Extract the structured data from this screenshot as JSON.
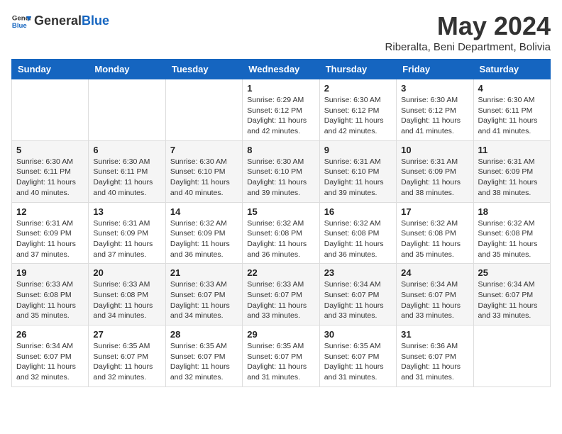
{
  "header": {
    "logo_general": "General",
    "logo_blue": "Blue",
    "month_title": "May 2024",
    "location": "Riberalta, Beni Department, Bolivia"
  },
  "days_of_week": [
    "Sunday",
    "Monday",
    "Tuesday",
    "Wednesday",
    "Thursday",
    "Friday",
    "Saturday"
  ],
  "weeks": [
    [
      {
        "day": "",
        "info": ""
      },
      {
        "day": "",
        "info": ""
      },
      {
        "day": "",
        "info": ""
      },
      {
        "day": "1",
        "info": "Sunrise: 6:29 AM\nSunset: 6:12 PM\nDaylight: 11 hours and 42 minutes."
      },
      {
        "day": "2",
        "info": "Sunrise: 6:30 AM\nSunset: 6:12 PM\nDaylight: 11 hours and 42 minutes."
      },
      {
        "day": "3",
        "info": "Sunrise: 6:30 AM\nSunset: 6:12 PM\nDaylight: 11 hours and 41 minutes."
      },
      {
        "day": "4",
        "info": "Sunrise: 6:30 AM\nSunset: 6:11 PM\nDaylight: 11 hours and 41 minutes."
      }
    ],
    [
      {
        "day": "5",
        "info": "Sunrise: 6:30 AM\nSunset: 6:11 PM\nDaylight: 11 hours and 40 minutes."
      },
      {
        "day": "6",
        "info": "Sunrise: 6:30 AM\nSunset: 6:11 PM\nDaylight: 11 hours and 40 minutes."
      },
      {
        "day": "7",
        "info": "Sunrise: 6:30 AM\nSunset: 6:10 PM\nDaylight: 11 hours and 40 minutes."
      },
      {
        "day": "8",
        "info": "Sunrise: 6:30 AM\nSunset: 6:10 PM\nDaylight: 11 hours and 39 minutes."
      },
      {
        "day": "9",
        "info": "Sunrise: 6:31 AM\nSunset: 6:10 PM\nDaylight: 11 hours and 39 minutes."
      },
      {
        "day": "10",
        "info": "Sunrise: 6:31 AM\nSunset: 6:09 PM\nDaylight: 11 hours and 38 minutes."
      },
      {
        "day": "11",
        "info": "Sunrise: 6:31 AM\nSunset: 6:09 PM\nDaylight: 11 hours and 38 minutes."
      }
    ],
    [
      {
        "day": "12",
        "info": "Sunrise: 6:31 AM\nSunset: 6:09 PM\nDaylight: 11 hours and 37 minutes."
      },
      {
        "day": "13",
        "info": "Sunrise: 6:31 AM\nSunset: 6:09 PM\nDaylight: 11 hours and 37 minutes."
      },
      {
        "day": "14",
        "info": "Sunrise: 6:32 AM\nSunset: 6:09 PM\nDaylight: 11 hours and 36 minutes."
      },
      {
        "day": "15",
        "info": "Sunrise: 6:32 AM\nSunset: 6:08 PM\nDaylight: 11 hours and 36 minutes."
      },
      {
        "day": "16",
        "info": "Sunrise: 6:32 AM\nSunset: 6:08 PM\nDaylight: 11 hours and 36 minutes."
      },
      {
        "day": "17",
        "info": "Sunrise: 6:32 AM\nSunset: 6:08 PM\nDaylight: 11 hours and 35 minutes."
      },
      {
        "day": "18",
        "info": "Sunrise: 6:32 AM\nSunset: 6:08 PM\nDaylight: 11 hours and 35 minutes."
      }
    ],
    [
      {
        "day": "19",
        "info": "Sunrise: 6:33 AM\nSunset: 6:08 PM\nDaylight: 11 hours and 35 minutes."
      },
      {
        "day": "20",
        "info": "Sunrise: 6:33 AM\nSunset: 6:08 PM\nDaylight: 11 hours and 34 minutes."
      },
      {
        "day": "21",
        "info": "Sunrise: 6:33 AM\nSunset: 6:07 PM\nDaylight: 11 hours and 34 minutes."
      },
      {
        "day": "22",
        "info": "Sunrise: 6:33 AM\nSunset: 6:07 PM\nDaylight: 11 hours and 33 minutes."
      },
      {
        "day": "23",
        "info": "Sunrise: 6:34 AM\nSunset: 6:07 PM\nDaylight: 11 hours and 33 minutes."
      },
      {
        "day": "24",
        "info": "Sunrise: 6:34 AM\nSunset: 6:07 PM\nDaylight: 11 hours and 33 minutes."
      },
      {
        "day": "25",
        "info": "Sunrise: 6:34 AM\nSunset: 6:07 PM\nDaylight: 11 hours and 33 minutes."
      }
    ],
    [
      {
        "day": "26",
        "info": "Sunrise: 6:34 AM\nSunset: 6:07 PM\nDaylight: 11 hours and 32 minutes."
      },
      {
        "day": "27",
        "info": "Sunrise: 6:35 AM\nSunset: 6:07 PM\nDaylight: 11 hours and 32 minutes."
      },
      {
        "day": "28",
        "info": "Sunrise: 6:35 AM\nSunset: 6:07 PM\nDaylight: 11 hours and 32 minutes."
      },
      {
        "day": "29",
        "info": "Sunrise: 6:35 AM\nSunset: 6:07 PM\nDaylight: 11 hours and 31 minutes."
      },
      {
        "day": "30",
        "info": "Sunrise: 6:35 AM\nSunset: 6:07 PM\nDaylight: 11 hours and 31 minutes."
      },
      {
        "day": "31",
        "info": "Sunrise: 6:36 AM\nSunset: 6:07 PM\nDaylight: 11 hours and 31 minutes."
      },
      {
        "day": "",
        "info": ""
      }
    ]
  ]
}
